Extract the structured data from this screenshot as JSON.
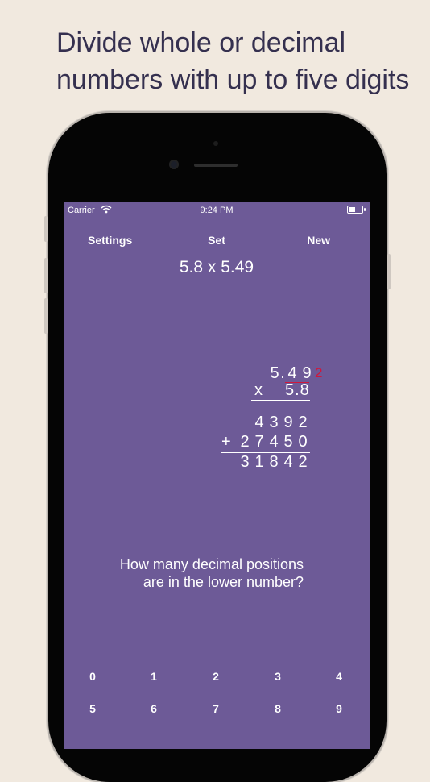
{
  "headline": "Divide whole or decimal numbers with up to five digits",
  "status": {
    "carrier": "Carrier",
    "time": "9:24 PM"
  },
  "nav": {
    "settings": "Settings",
    "set": "Set",
    "new": "New"
  },
  "problem": "5.8 x 5.49",
  "work": {
    "top_digits": [
      "5",
      ".",
      "4",
      "9"
    ],
    "carry": "2",
    "op": "x",
    "bottom": "5.8",
    "row1": [
      "4",
      "3",
      "9",
      "2"
    ],
    "plus": "+",
    "row2": [
      "2",
      "7",
      "4",
      "5",
      "0"
    ],
    "result": [
      "3",
      "1",
      "8",
      "4",
      "2"
    ]
  },
  "prompt_lines": [
    "How many decimal positions",
    "are in the lower number?"
  ],
  "keypad": [
    "0",
    "1",
    "2",
    "3",
    "4",
    "5",
    "6",
    "7",
    "8",
    "9"
  ],
  "colors": {
    "background": "#f1e9df",
    "screen": "#6d5a97",
    "carry": "#d0183c"
  }
}
